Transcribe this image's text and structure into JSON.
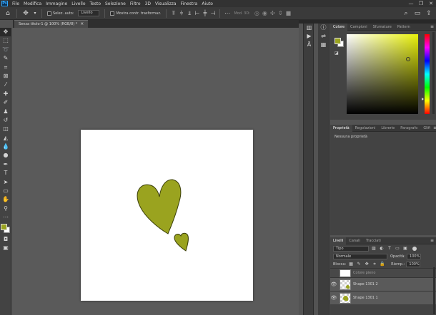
{
  "menubar": {
    "logo": "Ps",
    "items": [
      "File",
      "Modifica",
      "Immagine",
      "Livello",
      "Testo",
      "Selezione",
      "Filtro",
      "3D",
      "Visualizza",
      "Finestra",
      "Aiuto"
    ],
    "controls": [
      "—",
      "❐",
      "✕"
    ]
  },
  "options": {
    "auto_select_label": "Selez. auto:",
    "auto_select_value": "Livello",
    "transform_label": "Mostra contr. trasformaz.",
    "mode3d_label": "Mod. 3D:"
  },
  "document": {
    "tab_title": "Senza titolo-1 @ 100% (RGB/8) *",
    "close_glyph": "×"
  },
  "colors": {
    "foreground": "#9aa31f",
    "background": "#ffffff",
    "shape_fill": "#9aa31f",
    "shape_stroke": "#3b3f08"
  },
  "color_panel": {
    "tabs": [
      "Colore",
      "Campioni",
      "Sfumature",
      "Pattern"
    ]
  },
  "props_panel": {
    "tabs": [
      "Proprietà",
      "Regolazioni",
      "Librerie",
      "Paragrafo",
      "Glifi"
    ],
    "body": "Nessuna proprietà"
  },
  "layers_panel": {
    "tabs": [
      "Livelli",
      "Canali",
      "Tracciati"
    ],
    "filter": "Tipo",
    "blend_mode": "Normale",
    "opacity_label": "Opacità:",
    "opacity_value": "100%",
    "lock_label": "Blocca:",
    "fill_label": "Riemp.:",
    "fill_value": "100%",
    "layers": [
      {
        "name": "Colore pieno",
        "selected": false
      },
      {
        "name": "Shape 1301 2",
        "selected": true
      },
      {
        "name": "Shape 1301 1",
        "selected": true
      }
    ]
  }
}
